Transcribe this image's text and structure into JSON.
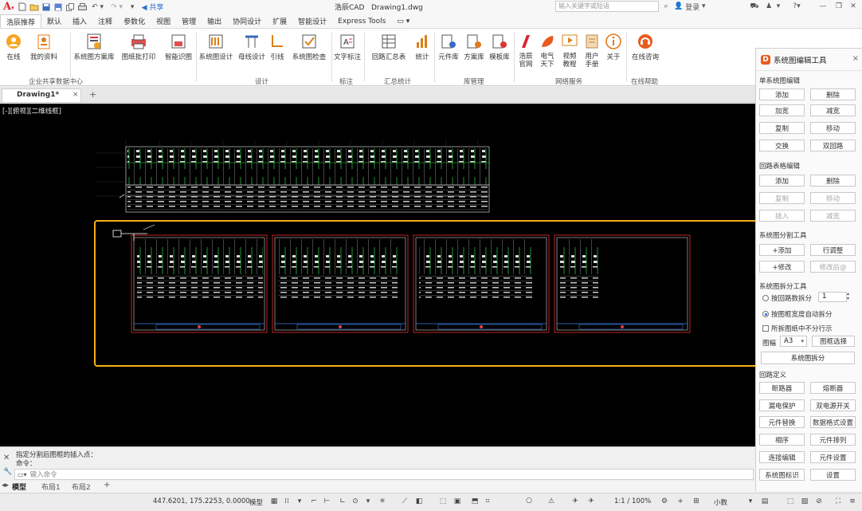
{
  "app": {
    "title_app": "浩辰CAD",
    "document": "Drawing1.dwg",
    "share": "共享",
    "search_placeholder": "输入关键字或短语",
    "user": "登录"
  },
  "menu": {
    "tabs": [
      "浩辰推荐",
      "默认",
      "插入",
      "注释",
      "参数化",
      "视图",
      "管理",
      "输出",
      "协同设计",
      "扩展",
      "智能设计",
      "Express Tools",
      "▭ ▾"
    ]
  },
  "ribbon": {
    "groups": [
      {
        "label": "企业共享数据中心",
        "buttons": [
          "在线",
          "我的资料"
        ]
      },
      {
        "label": "",
        "buttons": [
          "系统图方案库",
          "图纸批打印",
          "智能识图"
        ]
      },
      {
        "label": "设计",
        "buttons": [
          "系统图设计",
          "母线设计",
          "引线",
          "系统图检查"
        ]
      },
      {
        "label": "标注",
        "buttons": [
          "文字标注"
        ]
      },
      {
        "label": "汇总统计",
        "buttons": [
          "回路汇总表",
          "统计"
        ]
      },
      {
        "label": "库管理",
        "buttons": [
          "元件库",
          "方案库",
          "模板库"
        ]
      },
      {
        "label": "网络服务",
        "buttons": [
          "浩辰官网",
          "电气天下",
          "视频教程",
          "用户手册",
          "关于"
        ]
      },
      {
        "label": "在线帮助",
        "buttons": [
          "在线咨询"
        ]
      }
    ]
  },
  "doc_tab": {
    "label": "Drawing1*",
    "close": "×",
    "add": "+"
  },
  "canvas": {
    "view_label": "[-][俯视][二维线框]"
  },
  "command": {
    "history": "指定分割后图框的插入点：",
    "prompt": "命令：",
    "input_placeholder": "键入命令"
  },
  "layout_tabs": [
    "模型",
    "布局1",
    "布局2",
    "+"
  ],
  "status": {
    "coords": "447.6201, 175.2253, 0.0000",
    "model": "模型",
    "scale": "1:1 / 100%",
    "units": "小数"
  },
  "panel": {
    "title": "系统图编辑工具",
    "close": "×",
    "sections": {
      "s1": "单系统图编辑",
      "s2": "回路表格编辑",
      "s3": "系统图分割工具",
      "s4": "系统图拆分工具",
      "s5": "回路定义"
    },
    "s1_buttons": [
      "添加",
      "删除",
      "加宽",
      "减宽",
      "复制",
      "移动",
      "交换",
      "双回路"
    ],
    "s2_buttons": [
      "添加",
      "删除",
      "复制",
      "移动",
      "插入",
      "减宽"
    ],
    "s3_buttons": [
      "+添加",
      "行调整",
      "+修改",
      "修改后@"
    ],
    "split": {
      "opt1": "按回路数拆分",
      "opt1_value": "1",
      "opt2": "按图框宽度自动拆分",
      "check": "所拆图纸中不分行示",
      "frame_label": "图幅",
      "frame_value": "A3",
      "frame_btn": "图框选择",
      "action": "系统图拆分"
    },
    "s5_buttons": [
      "断路器",
      "熔断器",
      "漏电保护",
      "双电源开关",
      "元件替换",
      "数据格式设置",
      "相序",
      "元件排列",
      "连接编辑",
      "元件设置",
      "系统图标识",
      "设置"
    ]
  }
}
